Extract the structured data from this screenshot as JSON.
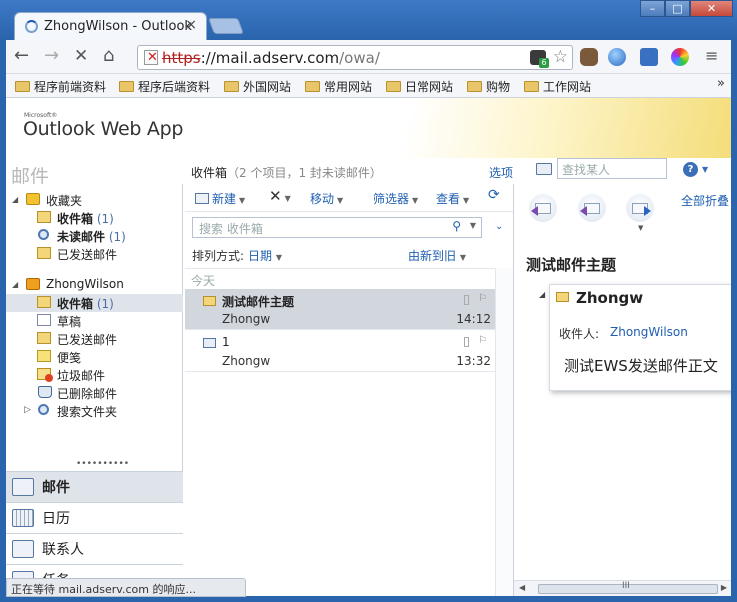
{
  "browser": {
    "tab_title": "ZhongWilson - Outlook",
    "tab_close": "×",
    "url_scheme": "https",
    "url_host": "://mail.adserv.com",
    "url_path": "/owa/",
    "window_buttons": {
      "minimize": "–",
      "maximize": "□",
      "close": "✕"
    },
    "bookmarks": [
      "程序前端资料",
      "程序后端资料",
      "外国网站",
      "常用网站",
      "日常网站",
      "购物",
      "工作网站"
    ],
    "bookmarks_more": "»",
    "status": "正在等待 mail.adserv.com 的响应..."
  },
  "owa": {
    "logo_small": "Microsoft®",
    "logo": "Outlook Web App",
    "section_title": "邮件",
    "folder_name": "收件箱",
    "folder_count": "（2 个项目，1 封未读邮件）",
    "options": "选项",
    "find_placeholder": "查找某人",
    "help": "?"
  },
  "nav": {
    "favorites": {
      "label": "收藏夹",
      "items": [
        {
          "label": "收件箱",
          "count": "(1)"
        },
        {
          "label": "未读邮件",
          "count": "(1)"
        },
        {
          "label": "已发送邮件",
          "count": ""
        }
      ]
    },
    "account": {
      "label": "ZhongWilson",
      "items": [
        {
          "label": "收件箱",
          "count": "(1)"
        },
        {
          "label": "草稿",
          "count": ""
        },
        {
          "label": "已发送邮件",
          "count": ""
        },
        {
          "label": "便笺",
          "count": ""
        },
        {
          "label": "垃圾邮件",
          "count": ""
        },
        {
          "label": "已删除邮件",
          "count": ""
        },
        {
          "label": "搜索文件夹",
          "count": ""
        }
      ]
    },
    "resize_dots": "••••••••••",
    "modules": [
      "邮件",
      "日历",
      "联系人",
      "任务"
    ]
  },
  "list": {
    "toolbar": {
      "new": "新建",
      "delete": "✕",
      "move": "移动",
      "filter": "筛选器",
      "view": "查看"
    },
    "search_placeholder": "搜索 收件箱",
    "sort_label": "排列方式:",
    "sort_value": "日期",
    "sort_order": "由新到旧",
    "group_header": "今天",
    "messages": [
      {
        "subject": "测试邮件主题",
        "from": "Zhongw",
        "time": "14:12"
      },
      {
        "subject": "1",
        "from": "Zhongw",
        "time": "13:32"
      }
    ]
  },
  "reading": {
    "collapse_all": "全部折叠",
    "subject": "测试邮件主题",
    "sender": "Zhongw",
    "to_label": "收件人:",
    "to_value": "ZhongWilson",
    "body": "测试EWS发送邮件正文",
    "scroll_grip": "III"
  },
  "colors": {
    "accent": "#1f5fb0",
    "selection": "#d2d7de",
    "banner_gold": "#f4dd7a"
  }
}
